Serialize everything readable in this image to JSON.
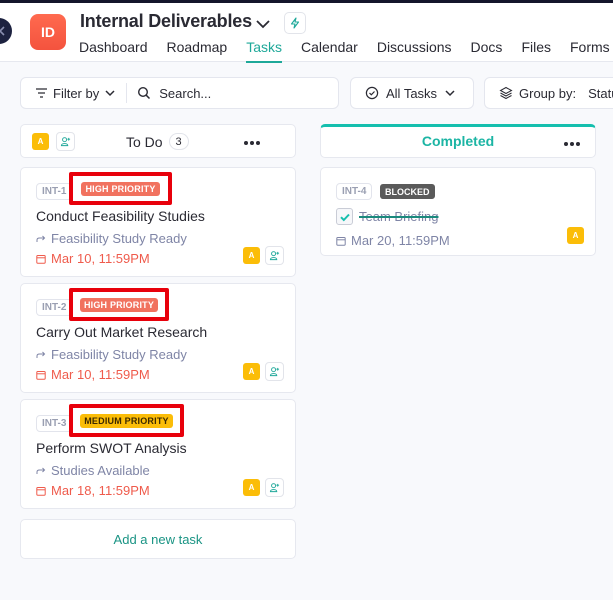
{
  "project": {
    "initials": "ID",
    "title": "Internal Deliverables",
    "avatar_color": "#f4533e"
  },
  "nav": {
    "tabs": [
      {
        "label": "Dashboard",
        "active": false
      },
      {
        "label": "Roadmap",
        "active": false
      },
      {
        "label": "Tasks",
        "active": true
      },
      {
        "label": "Calendar",
        "active": false
      },
      {
        "label": "Discussions",
        "active": false
      },
      {
        "label": "Docs",
        "active": false
      },
      {
        "label": "Files",
        "active": false
      },
      {
        "label": "Forms",
        "active": false
      }
    ],
    "accent": "#1ea899"
  },
  "toolbar": {
    "filter_label": "Filter by",
    "search_placeholder": "Search...",
    "view_label": "All Tasks",
    "group_label": "Group by:",
    "group_value": "Status"
  },
  "columns": {
    "todo": {
      "title": "To Do",
      "count": "3",
      "assignee_initial": "A"
    },
    "completed": {
      "title": "Completed",
      "accent": "#15bfae"
    }
  },
  "todo_cards": [
    {
      "id": "INT-1",
      "priority": "HIGH PRIORITY",
      "title": "Conduct Feasibility Studies",
      "dependency": "Feasibility Study Ready",
      "due": "Mar 10, 11:59PM",
      "assignee": "A"
    },
    {
      "id": "INT-2",
      "priority": "HIGH PRIORITY",
      "title": "Carry Out Market Research",
      "dependency": "Feasibility Study Ready",
      "due": "Mar 10, 11:59PM",
      "assignee": "A"
    },
    {
      "id": "INT-3",
      "priority": "MEDIUM PRIORITY",
      "title": "Perform SWOT Analysis",
      "dependency": "Studies Available",
      "due": "Mar 18, 11:59PM",
      "assignee": "A"
    }
  ],
  "completed_cards": [
    {
      "id": "INT-4",
      "status": "BLOCKED",
      "title": "Team Briefing",
      "done": true,
      "due": "Mar 20, 11:59PM",
      "assignee": "A"
    }
  ],
  "add_task_label": "Add a new task",
  "colors": {
    "high_priority": "#f1725f",
    "medium_priority": "#fbbd08",
    "overdue_date": "#ef5b4c",
    "highlight": "#e8000b",
    "avatar": "#fbbd08"
  }
}
